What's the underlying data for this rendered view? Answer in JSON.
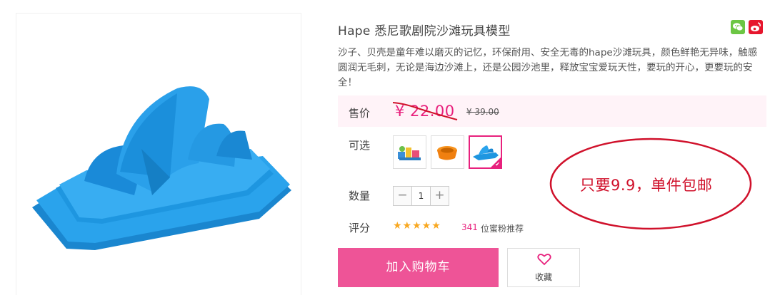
{
  "product": {
    "title": "Hape 悉尼歌剧院沙滩玩具模型",
    "description": "沙子、贝壳是童年难以磨灭的记忆，环保耐用、安全无毒的hape沙滩玩具，颜色鲜艳无异味，触感圆润无毛刺，无论是海边沙滩上，还是公园沙池里，释放宝宝爱玩天性，要玩的开心，更要玩的安全！",
    "image_icon": "opera-house-sand-mold"
  },
  "price": {
    "label": "售价",
    "current": "¥ 22.00",
    "original": "¥ 39.00"
  },
  "options": {
    "label": "可选",
    "items": [
      {
        "icon": "sand-toy-set",
        "selected": false
      },
      {
        "icon": "orange-bucket-mold",
        "selected": false
      },
      {
        "icon": "opera-house-mold",
        "selected": true
      }
    ]
  },
  "promo": {
    "text": "只要9.9，单件包邮",
    "color": "#d0112b"
  },
  "quantity": {
    "label": "数量",
    "minus": "−",
    "value": "1",
    "plus": "+"
  },
  "rating": {
    "label": "评分",
    "stars": "★★★★★",
    "star_count": 5,
    "count": "341",
    "suffix": "位蜜粉推荐"
  },
  "actions": {
    "add_to_cart": "加入购物车",
    "favorite": "收藏"
  },
  "share": {
    "wechat_icon": "wechat-icon",
    "weibo_icon": "weibo-icon"
  },
  "colors": {
    "accent": "#e8217d",
    "cart_button": "#ee5497",
    "price_bg": "#fff3f8",
    "star": "#f8a821",
    "product_blue": "#1e96e0"
  }
}
